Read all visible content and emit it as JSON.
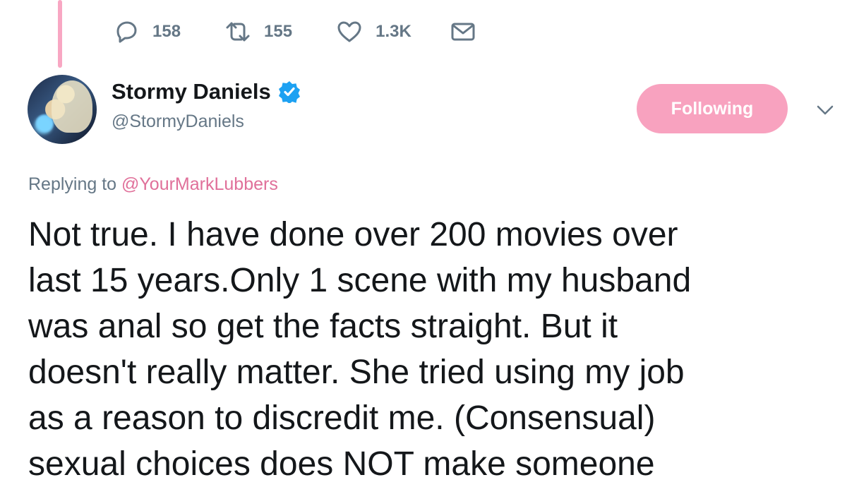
{
  "previous_tweet": {
    "reply_count": "158",
    "retweet_count": "155",
    "like_count": "1.3K"
  },
  "author": {
    "display_name": "Stormy Daniels",
    "handle": "@StormyDaniels",
    "verified": true
  },
  "follow_button_label": "Following",
  "replying": {
    "prefix": "Replying to",
    "mention": "@YourMarkLubbers"
  },
  "tweet_lines": [
    "Not true. I have done over 200 movies over",
    "last 15 years.Only 1 scene with my husband",
    "was anal so get the facts straight. But it",
    "doesn't really matter. She tried using my job",
    "as a reason to discredit me. (Consensual)",
    "sexual choices does NOT make someone"
  ],
  "colors": {
    "accent_pink": "#f8a2bf",
    "mention_pink": "#e0709a",
    "verified_blue": "#1da1f2",
    "muted_gray": "#657786"
  },
  "icons": [
    "reply-icon",
    "retweet-icon",
    "like-icon",
    "direct-message-icon",
    "verified-badge-icon",
    "chevron-down-icon"
  ]
}
